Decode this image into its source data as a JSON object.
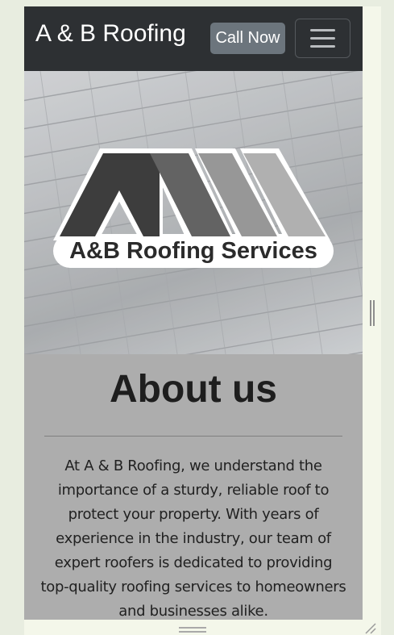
{
  "navbar": {
    "brand": "A & B Roofing",
    "call_button": "Call Now",
    "menu_icon": "hamburger-menu-icon"
  },
  "hero": {
    "logo_text": "A&B Roofing Services"
  },
  "about": {
    "title": "About us",
    "body": "At A & B Roofing, we understand the importance of a sturdy, reliable roof to protect your property. With years of experience in the industry, our team of expert roofers is dedicated to providing top-quality roofing services to homeowners and businesses alike."
  },
  "colors": {
    "navbar_bg": "#2d3033",
    "button_bg": "#6c757d",
    "about_bg": "#adadad",
    "page_bg": "#e8ede0"
  }
}
